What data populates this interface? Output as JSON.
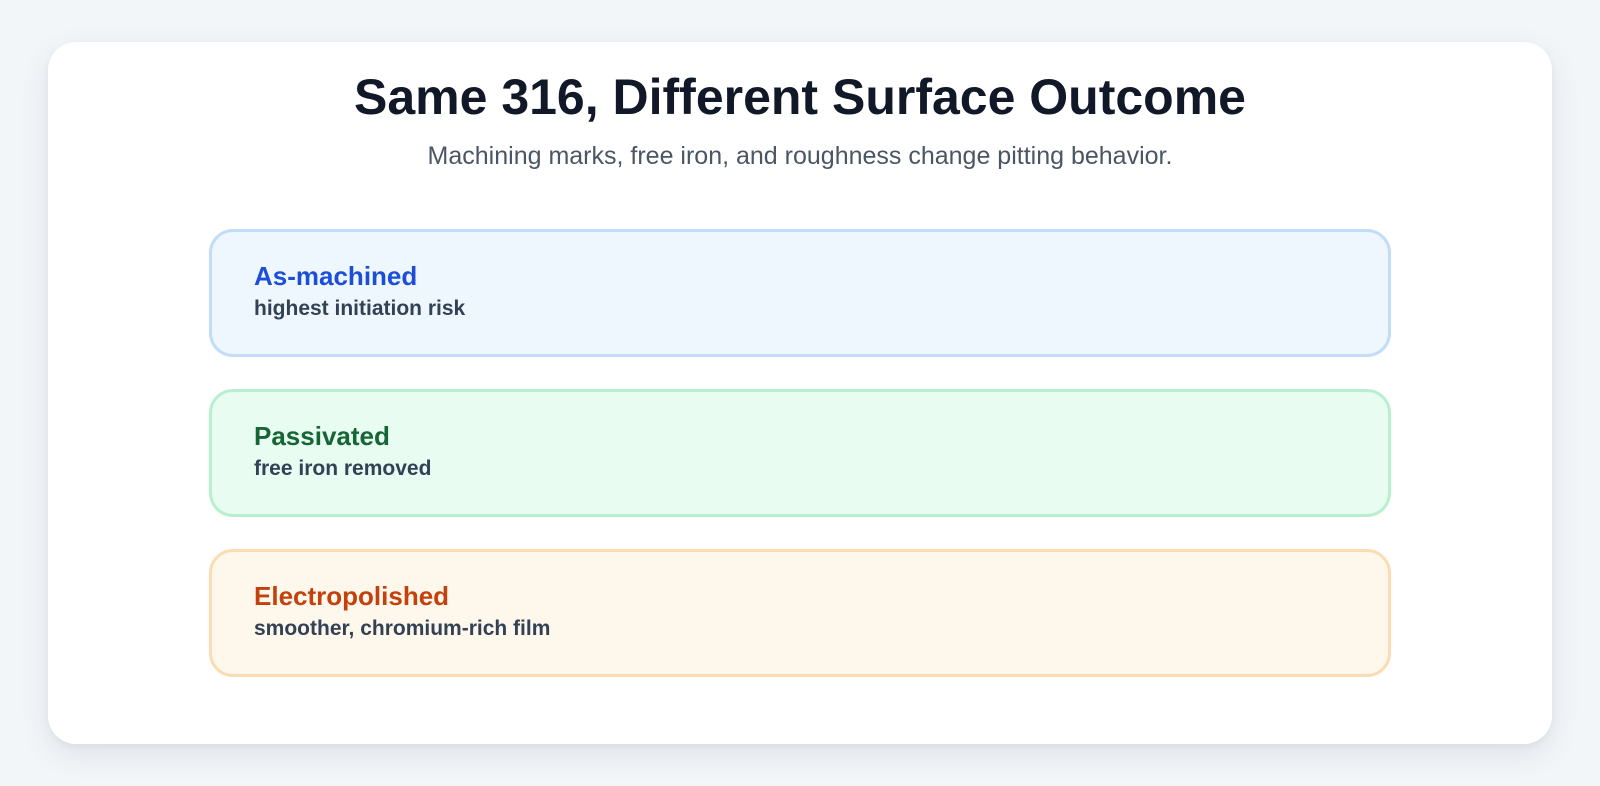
{
  "header": {
    "title": "Same 316, Different Surface Outcome",
    "subtitle": "Machining marks, free iron, and roughness change pitting behavior."
  },
  "finishes": [
    {
      "label": "As-machined",
      "description": "highest initiation risk",
      "accent": "#1d4ed8",
      "background": "#eef6fe",
      "border": "#c3dcf8"
    },
    {
      "label": "Passivated",
      "description": "free iron removed",
      "accent": "#166534",
      "background": "#e9fcf2",
      "border": "#b8f0cf"
    },
    {
      "label": "Electropolished",
      "description": "smoother, chromium-rich film",
      "accent": "#c2410c",
      "background": "#fef7ec",
      "border": "#fbdcb3"
    }
  ]
}
